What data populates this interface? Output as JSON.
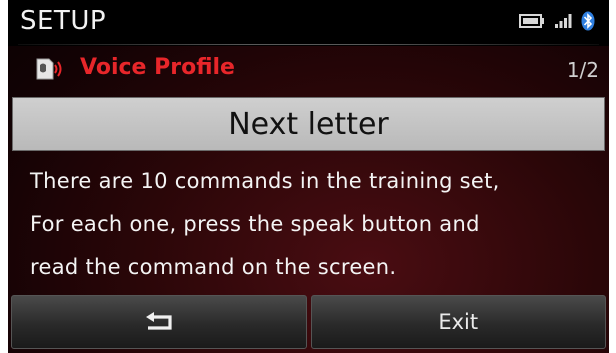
{
  "header": {
    "title": "SETUP",
    "icons": [
      "battery-icon",
      "signal-icon",
      "bluetooth-icon"
    ]
  },
  "subheader": {
    "icon": "voice-profile-icon",
    "label": "Voice Profile",
    "page": "1/2"
  },
  "letter_bar": {
    "text": "Next letter"
  },
  "message": {
    "lines": [
      "There are 10 commands in the training set,",
      "For each one, press the speak button and",
      "read the command on the screen."
    ]
  },
  "footer": {
    "back_icon": "back-arrow-icon",
    "exit_label": "Exit"
  },
  "colors": {
    "accent": "#e8262a",
    "background": "#2a0608",
    "bluetooth": "#2f7fe0"
  }
}
